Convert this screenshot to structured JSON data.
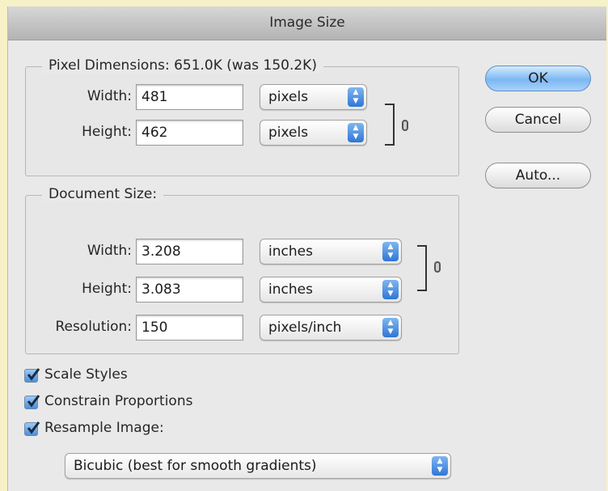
{
  "window": {
    "title": "Image Size"
  },
  "pixel_dimensions": {
    "legend": "Pixel Dimensions:  651.0K (was 150.2K)",
    "width_label": "Width:",
    "width_value": "481",
    "width_unit": "pixels",
    "height_label": "Height:",
    "height_value": "462",
    "height_unit": "pixels"
  },
  "document_size": {
    "legend": "Document Size:",
    "width_label": "Width:",
    "width_value": "3.208",
    "width_unit": "inches",
    "height_label": "Height:",
    "height_value": "3.083",
    "height_unit": "inches",
    "resolution_label": "Resolution:",
    "resolution_value": "150",
    "resolution_unit": "pixels/inch"
  },
  "buttons": {
    "ok": "OK",
    "cancel": "Cancel",
    "auto": "Auto..."
  },
  "options": {
    "scale_styles": {
      "label": "Scale Styles",
      "checked": true
    },
    "constrain_proportions": {
      "label": "Constrain Proportions",
      "checked": true
    },
    "resample_image": {
      "label": "Resample Image:",
      "checked": true
    }
  },
  "resample_method": "Bicubic (best for smooth gradients)",
  "colors": {
    "accent": "#4a8fde",
    "default_button": "#7cb7f2",
    "backdrop": "#f7f1c8"
  }
}
